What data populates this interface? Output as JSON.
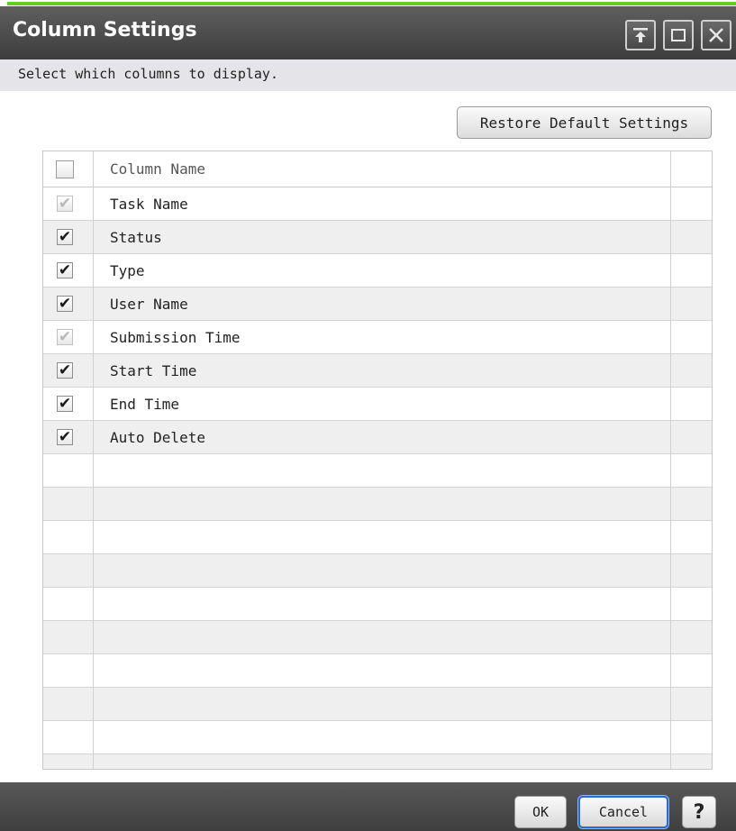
{
  "dialog": {
    "title": "Column Settings",
    "instruction": "Select which columns to display.",
    "restore_label": "Restore Default Settings"
  },
  "window_controls": {
    "pin_icon": "pin-to-top-icon",
    "maximize_icon": "maximize-icon",
    "close_icon": "close-icon"
  },
  "table": {
    "header": "Column Name",
    "rows": [
      {
        "name": "Task Name",
        "checked": true,
        "disabled": true
      },
      {
        "name": "Status",
        "checked": true,
        "disabled": false
      },
      {
        "name": "Type",
        "checked": true,
        "disabled": false
      },
      {
        "name": "User Name",
        "checked": true,
        "disabled": false
      },
      {
        "name": "Submission Time",
        "checked": true,
        "disabled": true
      },
      {
        "name": "Start Time",
        "checked": true,
        "disabled": false
      },
      {
        "name": "End Time",
        "checked": true,
        "disabled": false
      },
      {
        "name": "Auto Delete",
        "checked": true,
        "disabled": false
      }
    ]
  },
  "footer": {
    "ok_label": "OK",
    "cancel_label": "Cancel",
    "help_label": "?"
  },
  "colors": {
    "accent": "#66cc22",
    "titlebar": "#4a4a4a",
    "focus": "#2b6bd6"
  }
}
